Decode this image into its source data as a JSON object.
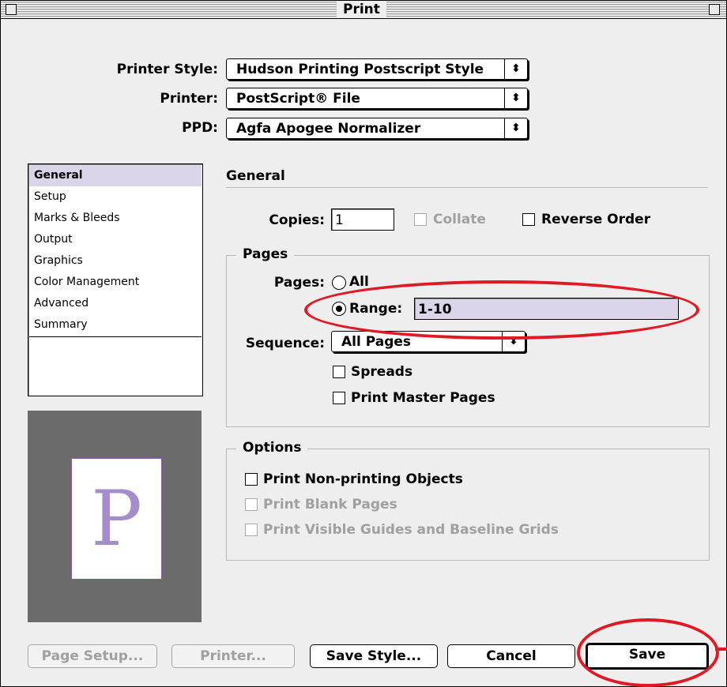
{
  "window": {
    "title": "Print"
  },
  "top": {
    "printer_style_label": "Printer Style:",
    "printer_style_value": "Hudson Printing Postscript Style",
    "printer_label": "Printer:",
    "printer_value": "PostScript® File",
    "ppd_label": "PPD:",
    "ppd_value": "Agfa Apogee Normalizer",
    "popup_arrows": "⬍"
  },
  "sidebar": {
    "items": [
      {
        "label": "General"
      },
      {
        "label": "Setup"
      },
      {
        "label": "Marks & Bleeds"
      },
      {
        "label": "Output"
      },
      {
        "label": "Graphics"
      },
      {
        "label": "Color Management"
      },
      {
        "label": "Advanced"
      },
      {
        "label": "Summary"
      }
    ],
    "selected": "General"
  },
  "preview": {
    "letter": "P"
  },
  "general": {
    "header": "General",
    "copies_label": "Copies:",
    "copies_value": "1",
    "collate_label": "Collate",
    "reverse_order_label": "Reverse Order"
  },
  "pages": {
    "group_label": "Pages",
    "pages_label": "Pages:",
    "all_label": "All",
    "range_label": "Range:",
    "range_value": "1-10",
    "sequence_label": "Sequence:",
    "sequence_value": "All Pages",
    "spreads_label": "Spreads",
    "print_master_pages_label": "Print Master Pages"
  },
  "options": {
    "group_label": "Options",
    "non_printing_label": "Print Non-printing Objects",
    "blank_pages_label": "Print Blank Pages",
    "visible_guides_label": "Print Visible Guides and Baseline Grids"
  },
  "buttons": {
    "page_setup": "Page Setup...",
    "printer": "Printer...",
    "save_style": "Save Style...",
    "cancel": "Cancel",
    "save": "Save"
  },
  "colors": {
    "highlight": "#dcd5ea",
    "annotation_red": "#e01a24",
    "preview_letter": "#a58ccd"
  }
}
